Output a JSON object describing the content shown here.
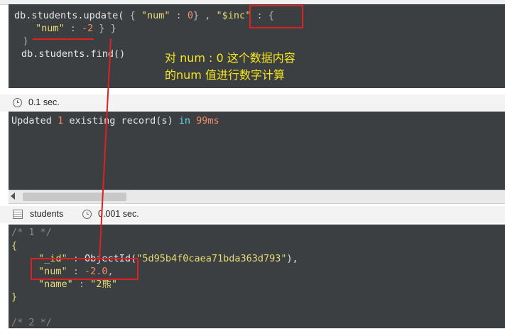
{
  "editor": {
    "line1": {
      "prefix": "db.students.update(",
      "open_brace": " {",
      "key_num": " \"num\"",
      "colon": " :",
      "zero": " 0",
      "close_brace": "}",
      "comma": " ,",
      "inc": " \"$inc\"",
      "colon2": " :",
      "open2": " {"
    },
    "line2": {
      "key_num": "\"num\"",
      "colon": " :",
      "value": " -2",
      "close": " } }"
    },
    "line3": ")",
    "line4": "db.students.find()"
  },
  "annotation": {
    "line1": "对 num : 0 这个数据内容",
    "line2": "的num 值进行数字计算"
  },
  "status1": {
    "elapsed": "0.1 sec."
  },
  "result1": {
    "word_updated": "Updated",
    "count": "1",
    "middle": " existing record(s) ",
    "word_in": "in",
    "duration": "99ms"
  },
  "status2": {
    "collection": "students",
    "elapsed": "0.001 sec."
  },
  "result2": {
    "comment1": "/* 1 */",
    "open_brace": "{",
    "id_key": "\"_id\"",
    "id_colon": " : ",
    "id_func": "ObjectId(",
    "id_value": "\"5d95b4f0caea71bda363d793\"",
    "id_close": "),",
    "num_key": "\"num\"",
    "num_colon": " : ",
    "num_value": "-2.0",
    "num_comma": ",",
    "name_key": "\"name\"",
    "name_colon": " : ",
    "name_value": "\"2熊\"",
    "close_brace": "}",
    "comment2": "/* 2 */"
  },
  "colors": {
    "editor_bg": "#3c3f41",
    "string": "#e6db74",
    "number": "#f28b6b",
    "keyword": "#66d9ef",
    "annotation": "#f5e51f",
    "highlight": "#e02020"
  }
}
